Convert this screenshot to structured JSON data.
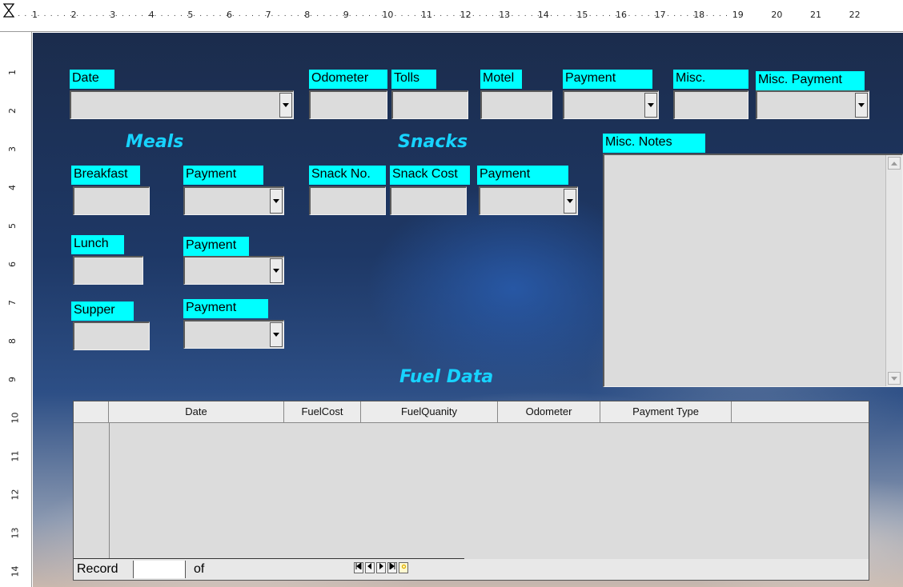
{
  "ruler": {
    "horizontal_numbers": [
      "1",
      "2",
      "3",
      "4",
      "5",
      "6",
      "7",
      "8",
      "9",
      "10",
      "11",
      "12",
      "13",
      "14",
      "15",
      "16",
      "17",
      "18",
      "19",
      "20",
      "21",
      "22"
    ],
    "vertical_numbers": [
      "1",
      "2",
      "3",
      "4",
      "5",
      "6",
      "7",
      "8",
      "9",
      "10",
      "11",
      "12",
      "13",
      "14"
    ]
  },
  "form": {
    "top_row": {
      "date_label": "Date",
      "odometer_label": "Odometer",
      "tolls_label": "Tolls",
      "motel_label": "Motel",
      "payment_label": "Payment",
      "misc_label": "Misc.",
      "misc_payment_label": "Misc. Payment"
    },
    "meals": {
      "heading": "Meals",
      "breakfast_label": "Breakfast",
      "breakfast_payment_label": "Payment",
      "lunch_label": "Lunch",
      "lunch_payment_label": "Payment",
      "supper_label": "Supper",
      "supper_payment_label": "Payment"
    },
    "snacks": {
      "heading": "Snacks",
      "snack_no_label": "Snack No.",
      "snack_cost_label": "Snack Cost",
      "payment_label": "Payment"
    },
    "misc_notes_label": "Misc. Notes",
    "fuel": {
      "heading": "Fuel Data",
      "columns": [
        "Date",
        "FuelCost",
        "FuelQuanity",
        "Odometer",
        "Payment Type"
      ],
      "record_label": "Record",
      "of_label": "of"
    }
  },
  "colors": {
    "label_bg": "#00ffff",
    "section_heading": "#17d3ff",
    "field_bg": "#dcdcdc"
  }
}
